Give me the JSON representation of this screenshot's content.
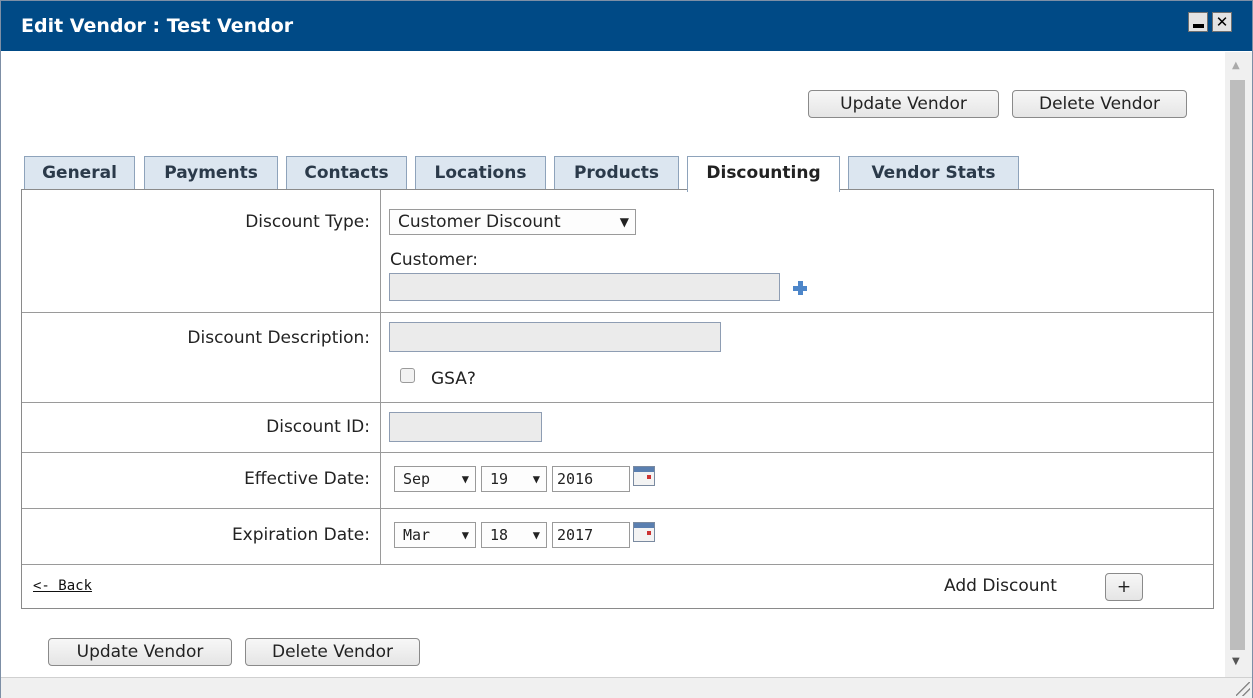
{
  "window": {
    "title": "Edit Vendor : Test Vendor",
    "minimize_icon": "minimize-icon",
    "close_icon": "close-icon"
  },
  "top_actions": {
    "update": "Update Vendor",
    "delete": "Delete Vendor"
  },
  "tabs": [
    {
      "label": "General"
    },
    {
      "label": "Payments"
    },
    {
      "label": "Contacts"
    },
    {
      "label": "Locations"
    },
    {
      "label": "Products"
    },
    {
      "label": "Discounting",
      "active": true
    },
    {
      "label": "Vendor Stats"
    }
  ],
  "form": {
    "discount_type": {
      "label": "Discount Type:",
      "value": "Customer Discount",
      "arrow": "▼"
    },
    "customer": {
      "label": "Customer:",
      "value": ""
    },
    "discount_description": {
      "label": "Discount Description:",
      "value": ""
    },
    "gsa": {
      "label": "GSA?",
      "checked": false
    },
    "discount_id": {
      "label": "Discount ID:",
      "value": ""
    },
    "effective_date": {
      "label": "Effective Date:",
      "month": "Sep",
      "day": "19",
      "year": "2016"
    },
    "expiration_date": {
      "label": "Expiration Date:",
      "month": "Mar",
      "day": "18",
      "year": "2017"
    }
  },
  "footer": {
    "back": "<- Back",
    "add_discount": "Add Discount",
    "add_symbol": "+"
  },
  "bottom_actions": {
    "update": "Update Vendor",
    "delete": "Delete Vendor"
  },
  "colors": {
    "titlebar": "#004a86",
    "tab_bg": "#dce6f0",
    "field_bg": "#ebebeb",
    "accent": "#4d86c9"
  }
}
